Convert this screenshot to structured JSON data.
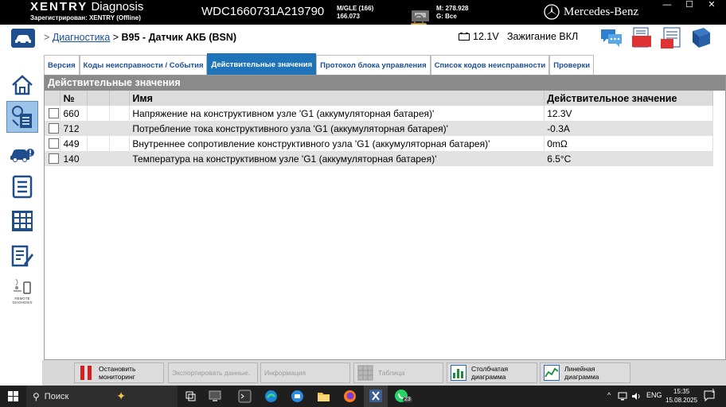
{
  "titlebar": {
    "brand_x": "XENTRY",
    "brand_rest": "Diagnosis",
    "registered": "Зарегистрирован: XENTRY (Offline)",
    "vin": "WDC1660731A219790",
    "model_line1": "M/GLE (166)",
    "model_line2": "166.073",
    "m_line": "M: 278.928",
    "g_line": "G: Все",
    "mercedes": "Mercedes-Benz"
  },
  "header": {
    "breadcrumb_link": "Диагностика",
    "breadcrumb_sep": ">",
    "breadcrumb_current": "B95 - Датчик АКБ (BSN)",
    "battery_voltage": "12.1V",
    "ignition": "Зажигание ВКЛ"
  },
  "tabs": [
    {
      "label": "Версия",
      "active": false
    },
    {
      "label": "Коды неисправности / События",
      "active": false
    },
    {
      "label": "Действительные значения",
      "active": true
    },
    {
      "label": "Протокол блока управления",
      "active": false
    },
    {
      "label": "Список кодов неисправности",
      "active": false
    },
    {
      "label": "Проверки",
      "active": false
    }
  ],
  "panel": {
    "title": "Действительные значения",
    "columns": [
      "№",
      "",
      "",
      "Имя",
      "Действительное значение"
    ],
    "rows": [
      {
        "num": "660",
        "name": "Напряжение на конструктивном узле 'G1 (аккумуляторная батарея)'",
        "value": "12.3V"
      },
      {
        "num": "712",
        "name": "Потребление тока конструктивного узла 'G1 (аккумуляторная батарея)'",
        "value": "-0.3A"
      },
      {
        "num": "449",
        "name": "Внутреннее сопротивление конструктивного узла 'G1 (аккумуляторная батарея)'",
        "value": "0mΩ"
      },
      {
        "num": "140",
        "name": "Температура на конструктивном узле 'G1 (аккумуляторная батарея)'",
        "value": "6.5°C"
      }
    ]
  },
  "leftnav": {
    "remote_line1": "REMOTE",
    "remote_line2": "DIAGNOSIS"
  },
  "bottombar": {
    "stop_line1": "Остановить",
    "stop_line2": "мониторинг",
    "export": "Экспортировать данные.",
    "info": "Информация",
    "table": "Таблица",
    "bar_line1": "Столбчатая",
    "bar_line2": "диаграмма",
    "line_line1": "Линейная",
    "line_line2": "диаграмма"
  },
  "taskbar": {
    "search": "Поиск",
    "whatsapp_badge": "23",
    "lang": "ENG",
    "time": "15:35",
    "date": "15.08.2025",
    "notif": "1"
  },
  "colors": {
    "accent": "#1e73b9",
    "link": "#1a4f9c",
    "panel_title": "#8a8a8a",
    "stop_red": "#d32020"
  }
}
